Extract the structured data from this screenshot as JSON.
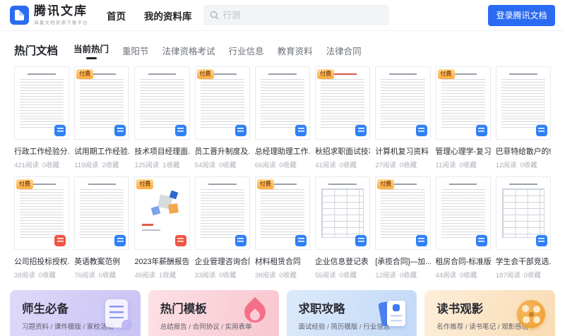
{
  "header": {
    "logo_title": "腾讯文库",
    "logo_subtitle": "海量文档资源下载平台",
    "nav": [
      {
        "label": "首页"
      },
      {
        "label": "我的资料库"
      }
    ],
    "search_placeholder": "行测",
    "login_button": "登录腾讯文档"
  },
  "section": {
    "title": "热门文档",
    "tabs": [
      {
        "label": "当前热门",
        "active": true
      },
      {
        "label": "重阳节",
        "active": false
      },
      {
        "label": "法律资格考试",
        "active": false
      },
      {
        "label": "行业信息",
        "active": false
      },
      {
        "label": "教育资料",
        "active": false
      },
      {
        "label": "法律合同",
        "active": false
      }
    ]
  },
  "paid_badge_label": "付费",
  "documents": {
    "rows": [
      [
        {
          "title": "行政工作经验分...",
          "reads": "421阅读",
          "collects": "0收藏",
          "paid": false,
          "file_type": "doc",
          "variant": "text"
        },
        {
          "title": "试用期工作经验...",
          "reads": "119阅读",
          "collects": "2收藏",
          "paid": true,
          "file_type": "doc",
          "variant": "text"
        },
        {
          "title": "技术项目经理面...",
          "reads": "125阅读",
          "collects": "1收藏",
          "paid": false,
          "file_type": "doc",
          "variant": "text"
        },
        {
          "title": "员工晋升制度及...",
          "reads": "54阅读",
          "collects": "0收藏",
          "paid": true,
          "file_type": "doc",
          "variant": "text"
        },
        {
          "title": "总经理助理工作...",
          "reads": "66阅读",
          "collects": "0收藏",
          "paid": false,
          "file_type": "doc",
          "variant": "text"
        },
        {
          "title": "秋招求职面试技巧",
          "reads": "41阅读",
          "collects": "0收藏",
          "paid": true,
          "file_type": "doc",
          "variant": "red-title"
        },
        {
          "title": "计算机复习资料",
          "reads": "27阅读",
          "collects": "0收藏",
          "paid": false,
          "file_type": "doc",
          "variant": "text"
        },
        {
          "title": "管理心理学-复习...",
          "reads": "11阅读",
          "collects": "0收藏",
          "paid": true,
          "file_type": "doc",
          "variant": "text"
        },
        {
          "title": "巴菲特给散户的9...",
          "reads": "12阅读",
          "collects": "0收藏",
          "paid": false,
          "file_type": "doc",
          "variant": "text"
        }
      ],
      [
        {
          "title": "公司招投标授权...",
          "reads": "38阅读",
          "collects": "0收藏",
          "paid": true,
          "file_type": "pdf",
          "variant": "text"
        },
        {
          "title": "英语教案范例",
          "reads": "76阅读",
          "collects": "0收藏",
          "paid": false,
          "file_type": "doc",
          "variant": "text"
        },
        {
          "title": "2023年薪酬报告...",
          "reads": "49阅读",
          "collects": "1收藏",
          "paid": true,
          "file_type": "pdf",
          "variant": "cover"
        },
        {
          "title": "企业管理咨询合同",
          "reads": "33阅读",
          "collects": "0收藏",
          "paid": false,
          "file_type": "doc",
          "variant": "text"
        },
        {
          "title": "材料租赁合同",
          "reads": "38阅读",
          "collects": "0收藏",
          "paid": true,
          "file_type": "doc",
          "variant": "text"
        },
        {
          "title": "企业信息登记表",
          "reads": "55阅读",
          "collects": "0收藏",
          "paid": false,
          "file_type": "doc",
          "variant": "table"
        },
        {
          "title": "[承揽合同]—加...",
          "reads": "12阅读",
          "collects": "0收藏",
          "paid": true,
          "file_type": "doc",
          "variant": "text"
        },
        {
          "title": "租房合同-标准版",
          "reads": "44阅读",
          "collects": "0收藏",
          "paid": false,
          "file_type": "doc",
          "variant": "text"
        },
        {
          "title": "学生会干部竞选...",
          "reads": "187阅读",
          "collects": "0收藏",
          "paid": false,
          "file_type": "doc",
          "variant": "table"
        }
      ]
    ]
  },
  "banners": [
    {
      "title": "师生必备",
      "subtitle": "习题资料 / 课件模版 / 家校活动",
      "icon": "document-icon",
      "bg_from": "#ded9f9",
      "bg_to": "#c9c3f4"
    },
    {
      "title": "热门模板",
      "subtitle": "总结报告 / 合同协议 / 实用表单",
      "icon": "flame-icon",
      "bg_from": "#fce0e5",
      "bg_to": "#f8c6cf"
    },
    {
      "title": "求职攻略",
      "subtitle": "面试经验 / 简历模版 / 行业信息",
      "icon": "resume-icon",
      "bg_from": "#dce9fb",
      "bg_to": "#c3d9f7"
    },
    {
      "title": "读书观影",
      "subtitle": "名作推荐 / 读书笔记 / 观影感悟",
      "icon": "film-reel-icon",
      "bg_from": "#fdeed9",
      "bg_to": "#f9dcb4"
    }
  ],
  "colors": {
    "accent_blue": "#2a6bf2",
    "doc_icon_blue": "#2f80f7",
    "pdf_icon_red": "#f25443",
    "badge_orange": "#ffab3f"
  }
}
